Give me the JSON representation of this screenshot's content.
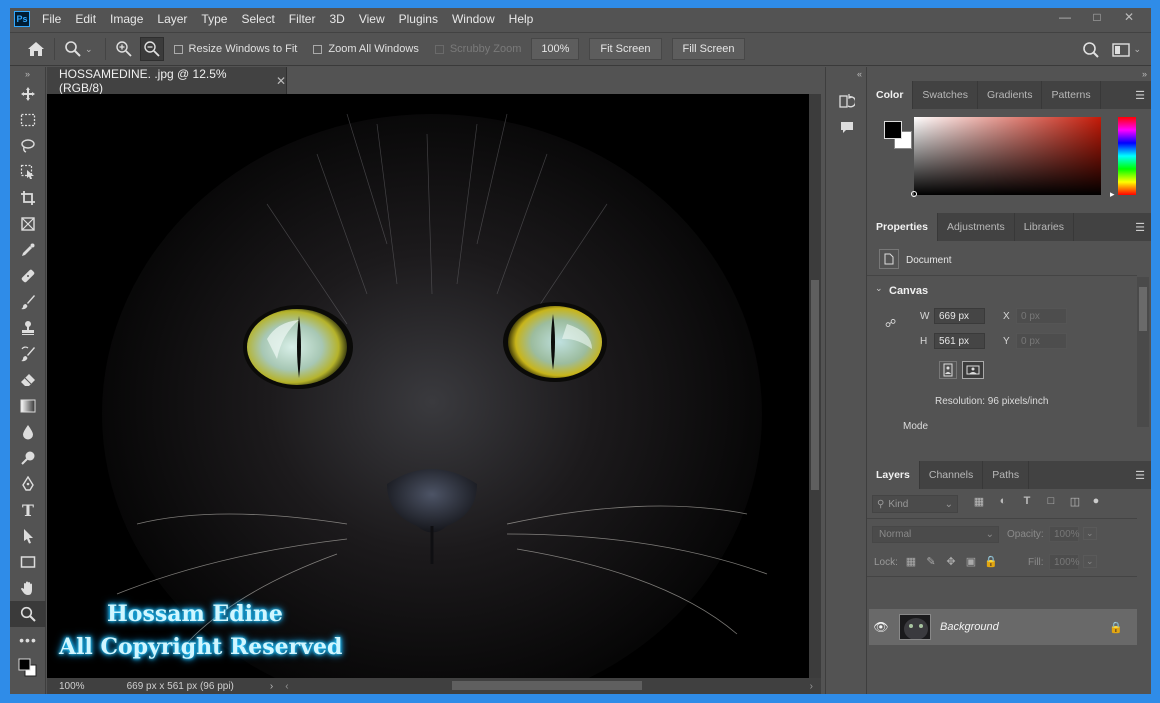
{
  "menubar": {
    "logo": "Ps",
    "items": [
      "File",
      "Edit",
      "Image",
      "Layer",
      "Type",
      "Select",
      "Filter",
      "3D",
      "View",
      "Plugins",
      "Window",
      "Help"
    ]
  },
  "options": {
    "resize_windows": "Resize Windows to Fit",
    "zoom_all": "Zoom All Windows",
    "scrubby": "Scrubby Zoom",
    "zoom_value": "100%",
    "fit_screen": "Fit Screen",
    "fill_screen": "Fill Screen"
  },
  "document": {
    "tab_title": "HOSSAMEDINE. .jpg @ 12.5% (RGB/8)",
    "zoom": "100%",
    "size_info": "669 px x 561 px (96 ppi)",
    "watermark_line1": "Hossam Edine",
    "watermark_line2": "All Copyright Reserved"
  },
  "color_panel": {
    "tabs": [
      "Color",
      "Swatches",
      "Gradients",
      "Patterns"
    ],
    "hue_color": "#c41a08"
  },
  "properties_panel": {
    "tabs": [
      "Properties",
      "Adjustments",
      "Libraries"
    ],
    "doc_label": "Document",
    "section": "Canvas",
    "w_label": "W",
    "w_value": "669 px",
    "h_label": "H",
    "h_value": "561 px",
    "x_label": "X",
    "x_value": "0 px",
    "y_label": "Y",
    "y_value": "0 px",
    "resolution": "Resolution: 96 pixels/inch",
    "mode": "Mode"
  },
  "layers_panel": {
    "tabs": [
      "Layers",
      "Channels",
      "Paths"
    ],
    "kind": "Kind",
    "blend_mode": "Normal",
    "opacity_label": "Opacity:",
    "opacity_value": "100%",
    "lock_label": "Lock:",
    "fill_label": "Fill:",
    "fill_value": "100%",
    "layer_name": "Background"
  },
  "accent": "#2f8ce8"
}
